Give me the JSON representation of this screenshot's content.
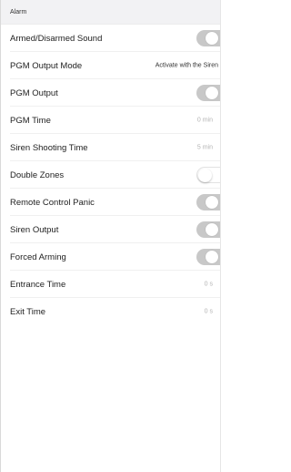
{
  "section": {
    "title": "Alarm"
  },
  "settings": [
    {
      "label": "Armed/Disarmed Sound",
      "type": "toggle",
      "state": "on"
    },
    {
      "label": "PGM Output Mode",
      "type": "text",
      "value": "Activate with the Siren"
    },
    {
      "label": "PGM Output",
      "type": "toggle",
      "state": "on"
    },
    {
      "label": "PGM Time",
      "type": "text",
      "value": "0 min"
    },
    {
      "label": "Siren Shooting Time",
      "type": "text",
      "value": "5 min"
    },
    {
      "label": "Double Zones",
      "type": "toggle",
      "state": "off"
    },
    {
      "label": "Remote Control Panic",
      "type": "toggle",
      "state": "on"
    },
    {
      "label": "Siren Output",
      "type": "toggle",
      "state": "on"
    },
    {
      "label": "Forced Arming",
      "type": "toggle",
      "state": "on"
    },
    {
      "label": "Entrance Time",
      "type": "text",
      "value": "0 s"
    },
    {
      "label": "Exit Time",
      "type": "text",
      "value": "0 s"
    }
  ],
  "colors": {
    "toggle_on": "#c8c8c8",
    "toggle_off": "#ffffff",
    "value_text": "#b3b3b3",
    "header_bg": "#f2f2f4"
  }
}
